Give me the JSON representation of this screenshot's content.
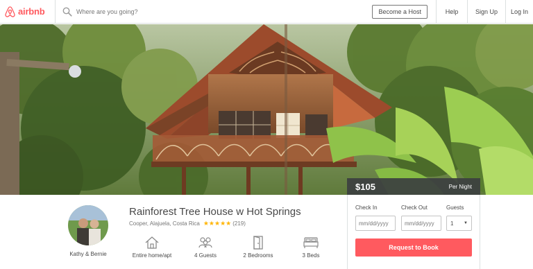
{
  "header": {
    "logo_text": "airbnb",
    "search_placeholder": "Where are you going?",
    "become_host": "Become a Host",
    "nav": {
      "help": "Help",
      "signup": "Sign Up",
      "login": "Log In"
    }
  },
  "pricing": {
    "amount": "$105",
    "unit": "Per Night"
  },
  "booking": {
    "checkin_label": "Check In",
    "checkout_label": "Check Out",
    "guests_label": "Guests",
    "checkin_placeholder": "mm/dd/yyyy",
    "checkout_placeholder": "mm/dd/yyyy",
    "guests_value": "1",
    "request_button": "Request to Book"
  },
  "listing": {
    "title": "Rainforest Tree House w Hot Springs",
    "location": "Cooper, Alajuela, Costa Rica",
    "rating_stars": 5,
    "review_count": "(219)",
    "host_name": "Kathy & Bernie",
    "amenities": [
      {
        "icon": "home-icon",
        "label": "Entire home/apt"
      },
      {
        "icon": "guests-icon",
        "label": "4 Guests"
      },
      {
        "icon": "door-icon",
        "label": "2 Bedrooms"
      },
      {
        "icon": "bed-icon",
        "label": "3 Beds"
      }
    ]
  },
  "colors": {
    "brand": "#ff5a5f",
    "star": "#ffb400",
    "text": "#484848",
    "price_bar": "#3c3f40"
  }
}
